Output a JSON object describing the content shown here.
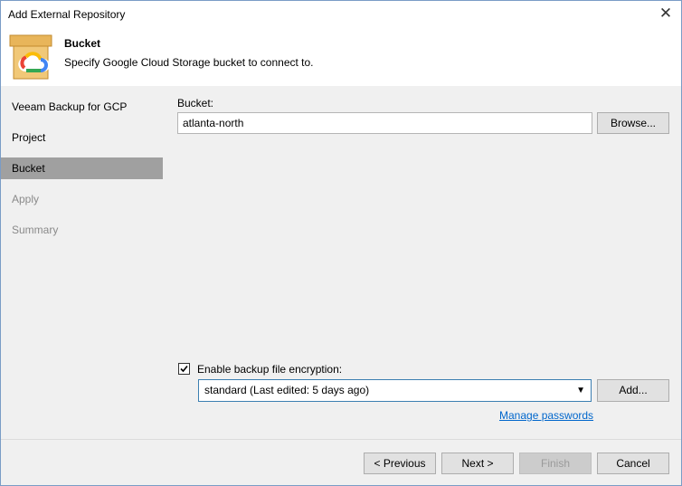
{
  "window": {
    "title": "Add External Repository"
  },
  "header": {
    "title": "Bucket",
    "subtitle": "Specify Google Cloud Storage bucket to connect to."
  },
  "sidebar": {
    "items": [
      {
        "label": "Veeam Backup for GCP",
        "state": "normal"
      },
      {
        "label": "Project",
        "state": "normal"
      },
      {
        "label": "Bucket",
        "state": "active"
      },
      {
        "label": "Apply",
        "state": "disabled"
      },
      {
        "label": "Summary",
        "state": "disabled"
      }
    ]
  },
  "bucket": {
    "label": "Bucket:",
    "value": "atlanta-north",
    "browse_label": "Browse..."
  },
  "encryption": {
    "checkbox_label": "Enable backup file encryption:",
    "checked": true,
    "selected_password": "standard (Last edited: 5 days ago)",
    "add_label": "Add...",
    "manage_link": "Manage passwords"
  },
  "footer": {
    "previous_label": "< Previous",
    "next_label": "Next >",
    "finish_label": "Finish",
    "cancel_label": "Cancel"
  },
  "colors": {
    "active_nav": "#a0a0a0",
    "link": "#0066cc",
    "accent_border": "#3c7fb1"
  }
}
